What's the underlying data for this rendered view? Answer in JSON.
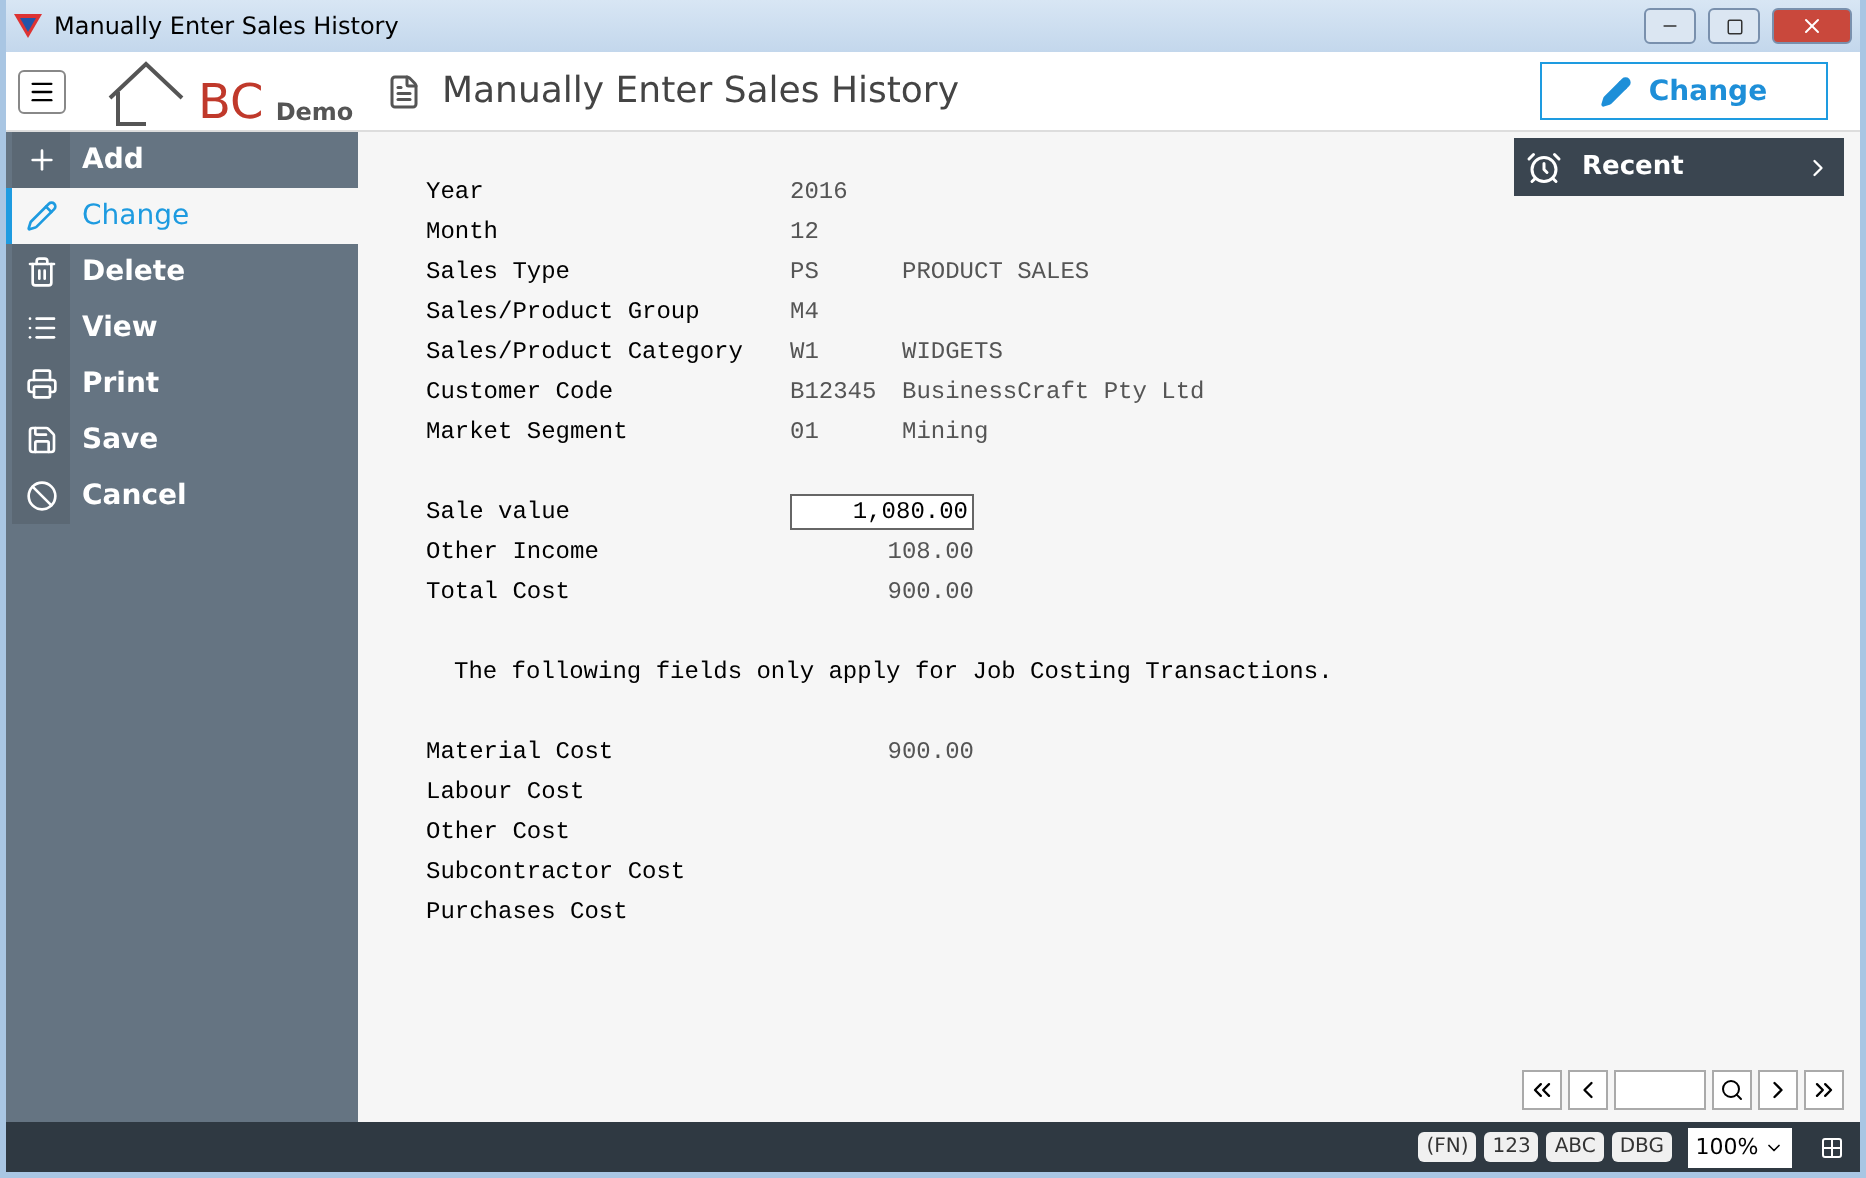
{
  "window": {
    "title": "Manually Enter Sales History"
  },
  "header": {
    "logo_text": "BC",
    "logo_sub": "Demo",
    "page_title": "Manually Enter Sales History",
    "action_button": "Change"
  },
  "sidebar": {
    "items": [
      {
        "label": "Add",
        "kind": "add",
        "selected": false
      },
      {
        "label": "Change",
        "kind": "change",
        "selected": true
      },
      {
        "label": "Delete",
        "kind": "delete",
        "selected": false
      },
      {
        "label": "View",
        "kind": "view",
        "selected": false
      },
      {
        "label": "Print",
        "kind": "print",
        "selected": false
      },
      {
        "label": "Save",
        "kind": "save",
        "selected": false
      },
      {
        "label": "Cancel",
        "kind": "cancel",
        "selected": false
      }
    ]
  },
  "recent": {
    "label": "Recent"
  },
  "details": [
    {
      "label": "Year",
      "code": "2016"
    },
    {
      "label": "Month",
      "code": "12"
    },
    {
      "label": "Sales Type",
      "code": "PS",
      "description": "PRODUCT SALES"
    },
    {
      "label": "Sales/Product Group",
      "code": "M4"
    },
    {
      "label": "Sales/Product Category",
      "code": "W1",
      "description": "WIDGETS"
    },
    {
      "label": "Customer Code",
      "code": "B12345",
      "description": "BusinessCraft Pty Ltd"
    },
    {
      "label": "Market Segment",
      "code": "01",
      "description": "Mining"
    }
  ],
  "amounts": [
    {
      "label": "Sale value",
      "value": "1,080.00",
      "kind": "input"
    },
    {
      "label": "Other Income",
      "value": "108.00",
      "kind": "text"
    },
    {
      "label": "Total Cost",
      "value": "900.00",
      "kind": "text"
    }
  ],
  "note": "The following fields only apply for Job Costing Transactions.",
  "job_costs": [
    {
      "label": "Material Cost",
      "value": "900.00"
    },
    {
      "label": "Labour Cost"
    },
    {
      "label": "Other Cost"
    },
    {
      "label": "Subcontractor Cost"
    },
    {
      "label": "Purchases Cost"
    }
  ],
  "status_bar": {
    "badges": [
      "(FN)",
      "123",
      "ABC",
      "DBG"
    ],
    "zoom": "100%"
  }
}
